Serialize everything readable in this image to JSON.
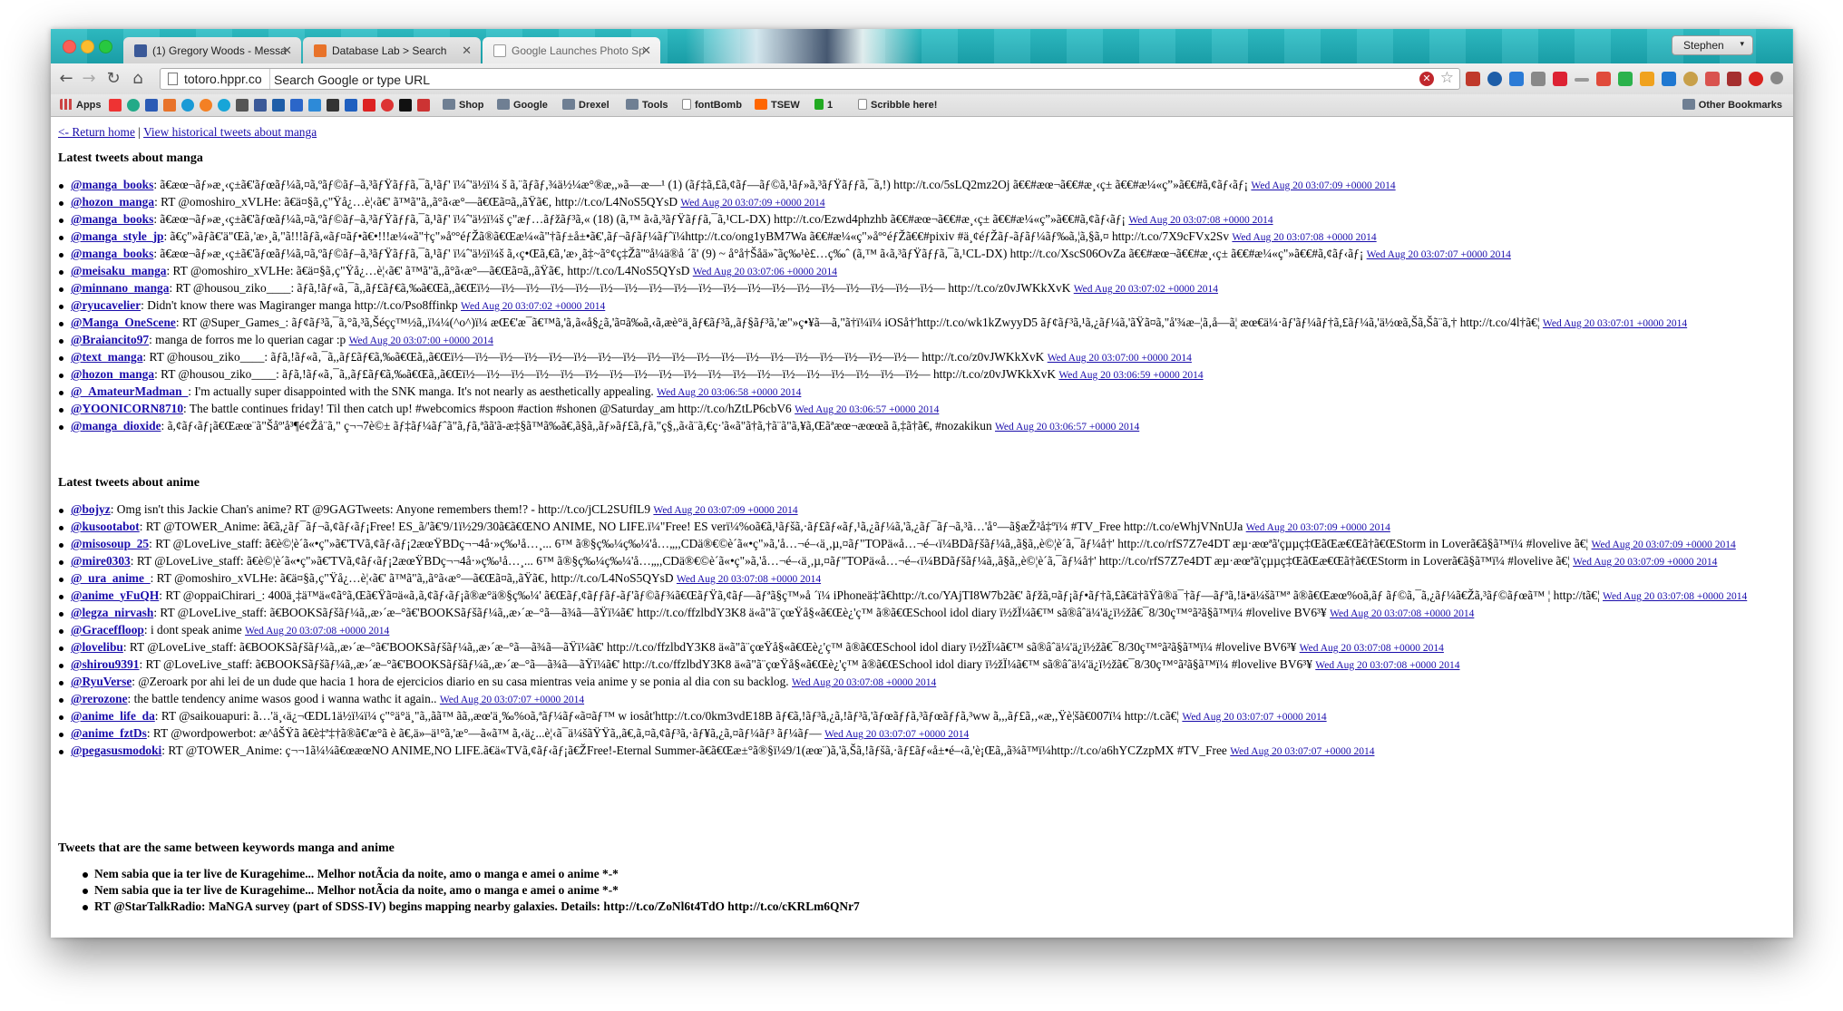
{
  "window": {
    "profile_name": "Stephen",
    "tabs": [
      {
        "label": "(1) Gregory Woods - Messa",
        "icon": "facebook-icon",
        "color": "#3b5998"
      },
      {
        "label": "Database Lab > Search",
        "icon": "database-lab-icon",
        "color": "#e8732a"
      },
      {
        "label": "Google Launches Photo Sp",
        "icon": "page-icon",
        "color": "#1aa3ad"
      }
    ]
  },
  "toolbar": {
    "site_chip": "totoro.hppr.co",
    "omnibox_placeholder": "Search Google or type URL"
  },
  "bookmarks": {
    "apps_label": "Apps",
    "items": [
      "Shop",
      "Google",
      "Drexel",
      "Tools",
      "fontBomb",
      "TSEW",
      "1",
      "Scribble here!"
    ],
    "other": "Other Bookmarks"
  },
  "page": {
    "return_home": "<- Return home",
    "separator": "|",
    "historical": "View historical tweets about manga",
    "manga_heading": "Latest tweets about manga",
    "anime_heading": "Latest tweets about anime",
    "same_heading": "Tweets that are the same between keywords manga and anime",
    "manga_tweets": [
      {
        "user": "@manga_books",
        "text": ": ã€æœ¬ãƒ»æ¸‹ç±ã€'ãƒœãƒ¼ã,¤ã,ºãƒ©ãƒ–ã,³ãƒŸãƒƒã,¯ã,¹ãƒ' ï¼ˆ'ä½ï¼ š ã,¨ãƒãƒ,¾ä½¼æ°®æ,,»ã—æ—¹ (1) (ãƒ‡ã,£ã,¢ãƒ—ãƒ©ã,¹ãƒ»ã,³ãƒŸãƒƒã,¯ã,!) http://t.co/5sLQ2mz2Oj ã€€#æœ¬ã€€#æ¸‹ç± ã€€#æ¼«ç”»ã€€#ã,¢ãƒ‹ãƒ¡",
        "ts": "Wed Aug 20 03:07:09 +0000 2014"
      },
      {
        "user": "@hozon_manga",
        "text": ": RT @omoshiro_xVLHe: ã€ä¤§ã‚ç\"Ÿå¿…è¦‹ã€' ã™ã\"ã,,ã°ã‹æ°—ã€Œã¤ã,,ãŸã€‚ http://t.co/L4NoS5QYsD",
        "ts": "Wed Aug 20 03:07:09 +0000 2014"
      },
      {
        "user": "@manga_books",
        "text": ": ã€æœ¬ãƒ»æ¸‹ç±ã€'ãƒœãƒ¼ã,¤ã,ºãƒ©ãƒ–ã,³ãƒŸãƒƒã,¯ã,¹ãƒ' ï¼ˆ'ä½ï¼š ç\"æƒ…ãƒžãƒ³ã,« (18) (ã,™ ã‹ã,³ãƒŸãƒƒã,¯ã,¹CL-DX) http://t.co/Ezwd4phzhb ã€€#æœ¬ã€€#æ¸‹ç± ã€€#æ¼«ç”»ã€€#ã,¢ãƒ‹ãƒ¡",
        "ts": "Wed Aug 20 03:07:08 +0000 2014"
      },
      {
        "user": "@manga_style_jp",
        "text": ": ã€ç\"»ãƒã€'ä\"Œã‚'æ›¸ã,\"ã!!!ãƒã,«ãƒ¤ãƒ•ã€•!!!æ¼«ã\"†ç\"»åº°éƒŽã®ã€Œæ¼«ã\"†ãƒ±å±•ã€',ãƒ¬ãƒãƒ¼ãƒˆï¼http://t.co/ong1yBM7Wa ã€€#æ¼«ç\"»åº°éƒŽã€€#pixiv #ä¸¢éƒŽãƒ-ãƒãƒ¼ãƒ‰ã,¦ã,§ã,¤ http://t.co/7X9cFVx2Sv",
        "ts": "Wed Aug 20 03:07:08 +0000 2014"
      },
      {
        "user": "@manga_books",
        "text": ": ã€æœ¬ãƒ»æ¸‹ç±ã€'ãƒœãƒ¼ã,¤ã,ºãƒ©ãƒ–ã,³ãƒŸãƒƒã,¯ã,¹ãƒ' ï¼ˆ'ä½ï¼š ã,‹ç•Œã,€ã‚'æ›¸ã‡~ã°¢ç‡Žã\"ºå¼ä®å ´ã' (9) ~ å°å†Šåä»˜ãç‰¹è£…ç‰ˆ (ã,™ ã‹ã,³ãƒŸãƒƒã,¯ã,¹CL-DX) http://t.co/XscS06OvZa ã€€#æœ¬ã€€#æ¸‹ç± ã€€#æ¼«ç\"»ã€€#ã,¢ãƒ‹ãƒ¡",
        "ts": "Wed Aug 20 03:07:07 +0000 2014"
      },
      {
        "user": "@meisaku_manga",
        "text": ": RT @omoshiro_xVLHe: ã€ä¤§ã‚ç\"Ÿå¿…è¦‹ã€' ã™ã\"ã,,ã°ã‹æ°—ã€Œã¤ã,,ãŸã€‚ http://t.co/L4NoS5QYsD",
        "ts": "Wed Aug 20 03:07:06 +0000 2014"
      },
      {
        "user": "@minnano_manga",
        "text": ": RT @housou_ziko____: ãƒã,!ãƒ«ã‚¯ã,,ãƒ£ãƒ€ã,‰ã€Œã,,ã€Œï½—ï½—ï½—ï½—ï½—ï½—ï½—ï½—ï½—ï½—ï½—ï½—ï½—ï½—ï½—ï½—ï½—ï½—ï½— http://t.co/z0vJWKkXvK",
        "ts": "Wed Aug 20 03:07:02 +0000 2014"
      },
      {
        "user": "@ryucavelier",
        "text": ": Didn't know there was Magiranger manga http://t.co/Pso8ffinkp",
        "ts": "Wed Aug 20 03:07:02 +0000 2014"
      },
      {
        "user": "@Manga_OneScene",
        "text": ": RT @Super_Games_: ãƒ¢ãƒ³ã,¯ã,°ã,³ã,Šéçç™½ã,,ï¼¼(^o^)ï¼ æŒ€'æ¯ã€™ã,'ã‚ã«å§¿ã,'ã¤ã‰ã,‹ã,æè°ä¸ãƒ€ãƒ³ã,,ãƒ§ãƒ³ã,'æ\"»ç•¥ã—ã,\"ã†ï¼ï¼ iOSå†'http://t.co/wk1kZwyyD5 ãƒ¢ãƒ³ã,¹ã,¿ãƒ¼ã,'ãŸã¤ã,\"å'¾æ–¦ã‚å—ã¦ æœ€ä¼·ãƒ'ãƒ¼ãƒ†ã,£ãƒ¼ã,'ä½œã,Šã,Šã¨ã,† http://t.co/4l†ã€¦",
        "ts": "Wed Aug 20 03:07:01 +0000 2014"
      },
      {
        "user": "@Braiancito97",
        "text": ": manga de forros me lo querian cagar :p",
        "ts": "Wed Aug 20 03:07:00 +0000 2014"
      },
      {
        "user": "@text_manga",
        "text": ": RT @housou_ziko____: ãƒã,!ãƒ«ã‚¯ã,,ãƒ£ãƒ€ã,‰ã€Œã,,ã€Œï½—ï½—ï½—ï½—ï½—ï½—ï½—ï½—ï½—ï½—ï½—ï½—ï½—ï½—ï½—ï½—ï½—ï½—ï½— http://t.co/z0vJWKkXvK",
        "ts": "Wed Aug 20 03:07:00 +0000 2014"
      },
      {
        "user": "@hozon_manga",
        "text": ": RT @housou_ziko____: ãƒã,!ãƒ«ã‚¯ã,,ãƒ£ãƒ€ã,‰ã€Œã,,ã€Œï½—ï½—ï½—ï½—ï½—ï½—ï½—ï½—ï½—ï½—ï½—ï½—ï½—ï½—ï½—ï½—ï½—ï½—ï½— http://t.co/z0vJWKkXvK",
        "ts": "Wed Aug 20 03:06:59 +0000 2014"
      },
      {
        "user": "@_AmateurMadman_",
        "text": ": I'm actually super disappointed with the SNK manga. It's not nearly as aesthetically appealing.",
        "ts": "Wed Aug 20 03:06:58 +0000 2014"
      },
      {
        "user": "@YOONICORN8710",
        "text": ": The battle continues friday! Til then catch up! #webcomics #spoon #action #shonen @Saturday_am http://t.co/hZtLP6cbV6",
        "ts": "Wed Aug 20 03:06:57 +0000 2014"
      },
      {
        "user": "@manga_dioxide",
        "text": ": ã,¢ãƒ‹ãƒ¡ã€Œæœ¨ã\"Šåº'å³¶é¢Žå¨ã,\" ç¬¬7è©± ãƒ‡ãƒ¼ãƒˆã\"ã,ƒã,ªãã'ã-æ‡§ã™ã‰ã€,ã§ã,,ãƒ»ãƒ£ã,ƒã,\"ç§,,ã‹ã¨ã,€ç·'ã«ã\"ã†ã,†ã¨ã\"ã,¥ã,Œãªæœ¬æœœã ã,‡ã†ã€, #nozakikun",
        "ts": "Wed Aug 20 03:06:57 +0000 2014"
      }
    ],
    "anime_tweets": [
      {
        "user": "@bojyz",
        "text": ": Omg isn't this Jackie Chan's anime? RT @9GAGTweets: Anyone remembers them!? - http://t.co/jCL2SUfIL9",
        "ts": "Wed Aug 20 03:07:09 +0000 2014"
      },
      {
        "user": "@kusootabot",
        "text": ": RT @TOWER_Anime: ã€ã,¿ãƒ¯ãƒ¬ã,¢ãƒ‹ãƒ¡Free! ES_ã/'ã€'9/1ï½29/30ã€ã€ŒNO ANIME, NO LIFE.ï¼\"Free! ES verï¼%oã€ã,¹ãƒšã,·ãƒ£ãƒ«ãƒ,¹ã,¿ãƒ¼ã,'ã,¿ãƒ¯ãƒ¬ã,³ã…'å°—ã§æŽ²å‡ºï¼ #TV_Free http://t.co/eWhjVNnUJa",
        "ts": "Wed Aug 20 03:07:09 +0000 2014"
      },
      {
        "user": "@misosoup_25",
        "text": ": RT @LoveLive_staff: ã€è©¦è´ã«•ç\"»ã€'TVã,¢ãƒ‹ãƒ¡2æœŸBDç¬¬4å·»ç‰¹å…¸... 6™ ã®§ç‰¼ç‰¼'å…„,,CDä®€©è´ã«•ç\"»ã,'å…¬é–‹ä¸,µ,¤ãƒ\"TOPä«å…¬é–‹ï¼BDãƒšãƒ¼ã,,ã§ã,,è©¦è´ã,¯ãƒ¼å†' http://t.co/rfS7Z7e4DT æµ·æœªã'çµµç‡ŒãŒæ€Œã†ã€ŒStorm in Loverã€ã§ã™ï¼ #lovelive ã€¦",
        "ts": "Wed Aug 20 03:07:09 +0000 2014"
      },
      {
        "user": "@mire0303",
        "text": ": RT @LoveLive_staff: ã€è©¦è´ã«•ç\"»ã€'TVã,¢ãƒ‹ãƒ¡2æœŸBDç¬¬4å·»ç‰¹å…¸... 6™ ã®§ç‰¼ç‰¼'å…„,,CDä®€©è´ã«•ç\"»ã,'å…¬é–‹ä¸,µ,¤ãƒ\"TOPä«å…¬é–‹ï¼BDãƒšãƒ¼ã,,ã§ã,,è©¦è´ã,¯ãƒ¼å†' http://t.co/rfS7Z7e4DT æµ·æœªã'çµµç‡ŒãŒæ€Œã†ã€ŒStorm in Loverã€ã§ã™ï¼ #lovelive ã€¦",
        "ts": "Wed Aug 20 03:07:09 +0000 2014"
      },
      {
        "user": "@_ura_anime_",
        "text": ": RT @omoshiro_xVLHe: ã€ä¤§ã‚ç\"Ÿå¿…è¦‹ã€' ã™ã\"ã,,ã°ã‹æ°—ã€Œã¤ã,,ãŸã€‚ http://t.co/L4NoS5QYsD",
        "ts": "Wed Aug 20 03:07:08 +0000 2014"
      },
      {
        "user": "@anime_yFuQH",
        "text": ": RT @oppaiChirari_: 400ä¸‡ä™ä«¢ã°ã,Œã€Ÿã¤ä«ã‚ã,¢ãƒ‹ãƒ¡ã®æ°ä®§ç‰¼' ã€Œãƒ,¢ãƒƒãƒ-ãƒ'ãƒ©ãƒ¾ã€ŒãƒŸã,¢ãƒ—ãƒªã§ç™»å ´ï¼ iPhoneä‡'ã€http://t.co/YAjTI8W7b2ã€' ãƒžã,¤ãƒ¡ãƒ•ãƒ†ã,£ã€ä†ãŸã®ä¯†ãƒ—ãƒªã,!ä•ä¼šã™ª ã®ã€Œæœ%oã,ãƒ ãƒ©ã,¯ã,¿ãƒ¼ã€Žã,³ãƒ©ãƒœã™ ¦ http://tã€¦",
        "ts": "Wed Aug 20 03:07:08 +0000 2014"
      },
      {
        "user": "@legza_nirvash",
        "text": ": RT @LoveLive_staff: ã€BOOKSãƒšãƒ¼ã,,æ›´æ–°ã€'BOOKSãƒšãƒ¼ã,,æ›´æ–°ã—ã¾ã—ãŸï¼ã€' http://t.co/ffzlbdY3K8 ä«ã\"ã¨çœŸå§«ã€Œè¿'ç™ ã®ã€ŒSchool idol diary ï½žÏ¼ã€™ sã®âˆä¼'ä¿ï½žã€¯8/30ç™°ã²ã§ã™ï¼ #lovelive BV6³¥",
        "ts": "Wed Aug 20 03:07:08 +0000 2014"
      },
      {
        "user": "@Graceffloop",
        "text": ": i dont speak anime",
        "ts": "Wed Aug 20 03:07:08 +0000 2014"
      },
      {
        "user": "@lovelibu",
        "text": ": RT @LoveLive_staff: ã€BOOKSãƒšãƒ¼ã,,æ›´æ–°ã€'BOOKSãƒšãƒ¼ã,,æ›´æ–°ã—ã¾ã—ãŸï¼ã€' http://t.co/ffzlbdY3K8 ä«ã\"ã¨çœŸå§«ã€Œè¿'ç™ ã®ã€ŒSchool idol diary ï½žÏ¼ã€™ sã®âˆä¼'ä¿ï½žã€¯8/30ç™°ã²ã§ã™ï¼ #lovelive BV6³¥",
        "ts": "Wed Aug 20 03:07:08 +0000 2014"
      },
      {
        "user": "@shirou9391",
        "text": ": RT @LoveLive_staff: ã€BOOKSãƒšãƒ¼ã,,æ›´æ–°ã€'BOOKSãƒšãƒ¼ã,,æ›´æ–°ã—ã¾ã—ãŸï¼ã€' http://t.co/ffzlbdY3K8 ä«ã\"ã¨çœŸå§«ã€Œè¿'ç™ ã®ã€ŒSchool idol diary ï½žÏ¼ã€™ sã®âˆä¼'ä¿ï½žã€¯8/30ç™°ã²ã§ã™ï¼ #lovelive BV6³¥",
        "ts": "Wed Aug 20 03:07:08 +0000 2014"
      },
      {
        "user": "@RyuVerse",
        "text": ": @Zeroark por ahi lei de un dude que hacia 1 hora de ejercicios diario en su casa mientras veia anime y se ponia al dia con su backlog.",
        "ts": "Wed Aug 20 03:07:08 +0000 2014"
      },
      {
        "user": "@rerozone",
        "text": ": the battle tendency anime wasos good i wanna wathc it again..",
        "ts": "Wed Aug 20 03:07:07 +0000 2014"
      },
      {
        "user": "@anime_life_da",
        "text": ": RT @saikouapuri: ã…'ä¸‹ä¿¬ŒDL1ä½ï¼ï¼ ç\"°ä°ä¸\"ã,,ãã™ ãã,,æœ'ä¸‰%oã,ªãƒ¼ãƒ«ã¤ãƒ™ w iosåt'http://t.co/0km3vdE18B ãƒ€ã,!ãƒ³ã,¿ã,!ãƒ³ã,'ãƒœãƒƒã,³ãƒœãƒƒã,³ww ã,,,ãƒ£ã‚,«æ,,Ÿè¦šã€007ï¼ http://t.cã€¦",
        "ts": "Wed Aug 20 03:07:07 +0000 2014"
      },
      {
        "user": "@anime_fztDs",
        "text": ": RT @wordpowerbot: æ^åŠŸã ã€è‡ª‡†ã®ã€'æ°ã è ã€,ä»–ä¹°ã,'æ°—ã«ã™ ã,‹ä¿...è¦‹ã¯ä¼šãŸŸã,,ã€,ã,¤ã,¢ãƒ³ã,·ãƒ¥ã,¿ã,¤ãƒ¼ãƒ³ ãƒ¼ãƒ—",
        "ts": "Wed Aug 20 03:07:07 +0000 2014"
      },
      {
        "user": "@pegasusmodoki",
        "text": ": RT @TOWER_Anime: ç¬¬1ã¼¼ã€œæœNO ANIME,NO LIFE.ã€ä«TVã,¢ãƒ‹ãƒ¡ã€ŽFree!-Eternal Summer-ã€ã€Œæ±°ã®§ï¼9/1(æœ¨)ã,'ã,Šã,!ãƒšã,·ãƒ£ãƒ«å±•é–‹ã,'è¡Œã,,ã¾ã™ï¼http://t.co/a6hYCZzpMX #TV_Free",
        "ts": "Wed Aug 20 03:07:07 +0000 2014"
      }
    ],
    "same_tweets": [
      "Nem sabia que ia ter live de Kuragehime... Melhor notÃ­cia da noite, amo o manga e amei o anime *-*",
      "Nem sabia que ia ter live de Kuragehime... Melhor notÃ­cia da noite, amo o manga e amei o anime *-*",
      "RT @StarTalkRadio: MaNGA survey (part of SDSS-IV) begins mapping nearby galaxies. Details: http://t.co/ZoNl6t4TdO http://t.co/cKRLm6QNr7"
    ]
  }
}
